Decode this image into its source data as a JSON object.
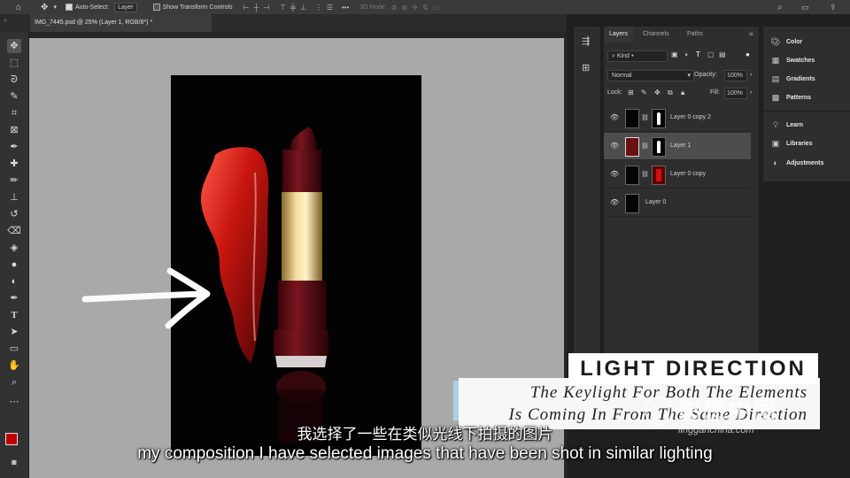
{
  "options_bar": {
    "auto_select_label": "Auto-Select:",
    "auto_select_value": "Layer",
    "show_transform_label": "Show Transform Controls",
    "mode_3d_label": "3D Mode:"
  },
  "document_tab": {
    "title": "IMG_7445.psd @ 25% (Layer 1, RGB/8*) *"
  },
  "layers_panel": {
    "tabs": [
      "Layers",
      "Channels",
      "Paths"
    ],
    "filter_kind": "Kind",
    "blend_mode": "Normal",
    "opacity_label": "Opacity:",
    "opacity_value": "100%",
    "lock_label": "Lock:",
    "fill_label": "Fill:",
    "fill_value": "100%",
    "layers": [
      {
        "name": "Layer 0 copy 2",
        "selected": false,
        "mask_shape": "lipstick"
      },
      {
        "name": "Layer 1",
        "selected": true,
        "mask_shape": "lipstick"
      },
      {
        "name": "Layer 0 copy",
        "selected": false,
        "mask_shape": "red-glow"
      },
      {
        "name": "Layer 0",
        "selected": false,
        "mask_shape": "none"
      }
    ]
  },
  "side_panel": {
    "items": [
      {
        "label": "Color",
        "icon": "palette-icon"
      },
      {
        "label": "Swatches",
        "icon": "grid-icon"
      },
      {
        "label": "Gradients",
        "icon": "gradient-icon"
      },
      {
        "label": "Patterns",
        "icon": "pattern-icon"
      },
      {
        "label": "Learn",
        "icon": "bulb-icon"
      },
      {
        "label": "Libraries",
        "icon": "library-icon"
      },
      {
        "label": "Adjustments",
        "icon": "adjustments-icon"
      }
    ]
  },
  "overlay_card": {
    "title": "LIGHT DIRECTION",
    "line1": "The Keylight For Both The Elements",
    "line2": "Is Coming In From The Same Direction"
  },
  "subtitles": {
    "chinese": "我选择了一些在类似光线下拍摄的图片",
    "english": "my composition I have selected images that have been shot in similar lighting"
  },
  "watermark": {
    "brand": "影感中国",
    "url": "lingganchina.com"
  },
  "colors": {
    "foreground": "#c00000",
    "background": "#ffffff",
    "lipstick": "#6a0f17",
    "accent": "#a9d3e4"
  }
}
